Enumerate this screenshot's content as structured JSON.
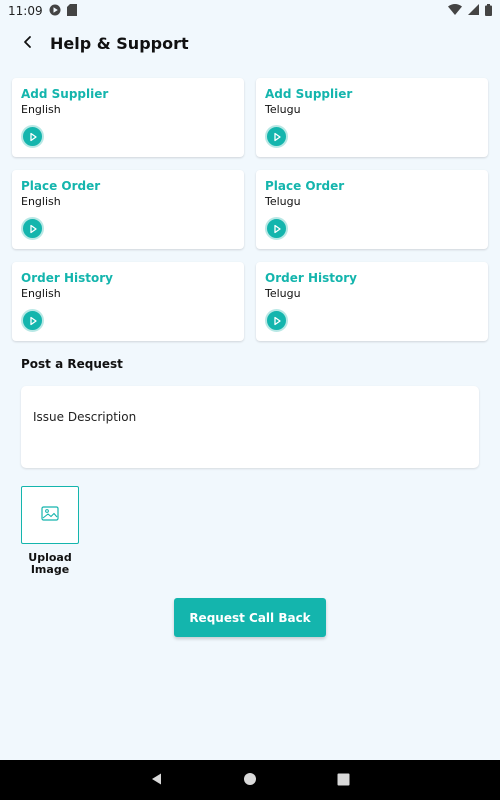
{
  "status_bar": {
    "time": "11:09",
    "icons": [
      "google-play-icon",
      "sd-card-icon",
      "wifi-icon",
      "signal-icon",
      "battery-icon"
    ]
  },
  "app_bar": {
    "title": "Help & Support",
    "back_icon": "back-arrow-icon"
  },
  "tutorials": [
    {
      "title": "Add Supplier",
      "language": "English"
    },
    {
      "title": "Add Supplier",
      "language": "Telugu"
    },
    {
      "title": "Place Order",
      "language": "English"
    },
    {
      "title": "Place Order",
      "language": "Telugu"
    },
    {
      "title": "Order History",
      "language": "English"
    },
    {
      "title": "Order History",
      "language": "Telugu"
    }
  ],
  "request": {
    "section_title": "Post a Request",
    "description_placeholder": "Issue Description",
    "upload_label": "Upload Image",
    "submit_label": "Request Call Back"
  },
  "colors": {
    "accent": "#14b5ad",
    "background": "#f1f8fd"
  }
}
